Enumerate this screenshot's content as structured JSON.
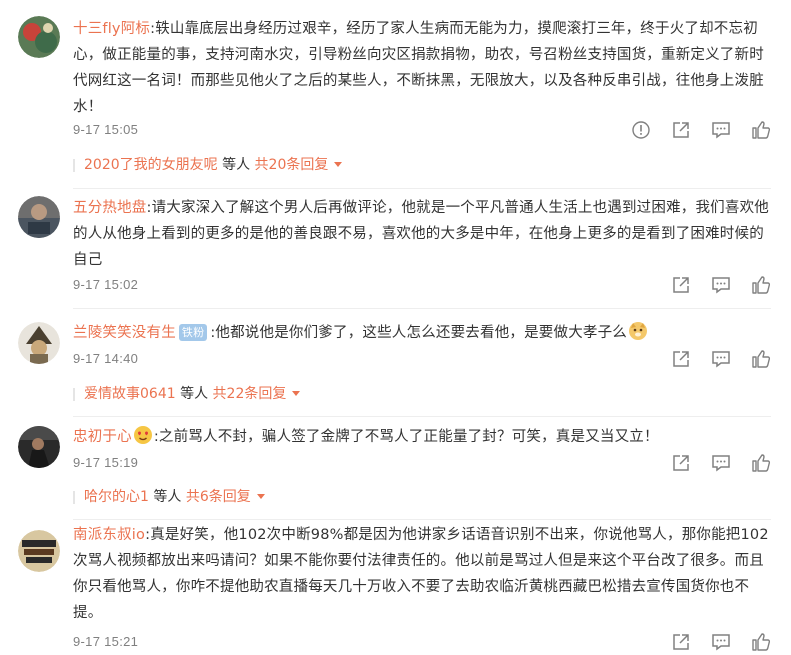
{
  "comments": [
    {
      "username": "十三fly阿标",
      "badge": "",
      "text": ":轶山靠底层出身经历过艰辛，经历了家人生病而无能为力，摸爬滚打三年，终于火了却不忘初心，做正能量的事，支持河南水灾，引导粉丝向灾区捐款捐物，助农，号召粉丝支持国货，重新定义了新时代网红这一名词！而那些见他火了之后的某些人，不断抹黑，无限放大，以及各种反串引战，往他身上泼脏水！",
      "time": "9-17 15:05",
      "reply": {
        "user": "2020了我的女朋友呢",
        "mid": " 等人 ",
        "count": "共20条回复"
      }
    },
    {
      "username": "五分热地盘",
      "badge": "",
      "text": ":请大家深入了解这个男人后再做评论，他就是一个平凡普通人生活上也遇到过困难，我们喜欢他的人从他身上看到的更多的是他的善良跟不易，喜欢他的大多是中年，在他身上更多的是看到了困难时候的自己",
      "time": "9-17 15:02"
    },
    {
      "username": "兰陵笑笑没有生",
      "badge": "铁粉",
      "text": ":他都说他是你们爹了，这些人怎么还要去看他，是要做大孝子么",
      "time": "9-17 14:40",
      "reply": {
        "user": "爱情故事0641",
        "mid": " 等人 ",
        "count": "共22条回复"
      }
    },
    {
      "username": "忠初于心",
      "badge": "",
      "text": ":之前骂人不封，骗人签了金牌了不骂人了正能量了封？可笑，真是又当又立！",
      "time": "9-17 15:19",
      "reply": {
        "user": "哈尔的心1",
        "mid": " 等人 ",
        "count": "共6条回复"
      }
    },
    {
      "username": "南派东叔io",
      "badge": "",
      "text": ":真是好笑，他102次中断98%都是因为他讲家乡话语音识别不出来，你说他骂人，那你能把102次骂人视频都放出来吗请问？如果不能你要付法律责任的。他以前是骂过人但是来这个平台改了很多。而且你只看他骂人，你咋不提他助农直播每天几十万收入不要了去助农临沂黄桃西藏巴松措去宣传国货你也不提。",
      "time": "9-17 15:21"
    }
  ],
  "icons": {
    "report": "report-icon",
    "share": "share-icon",
    "comment": "comment-icon",
    "like": "like-icon"
  },
  "colors": {
    "username": "#eb7350",
    "text": "#333333",
    "time": "#808080",
    "badge": "#a3c8ea"
  }
}
